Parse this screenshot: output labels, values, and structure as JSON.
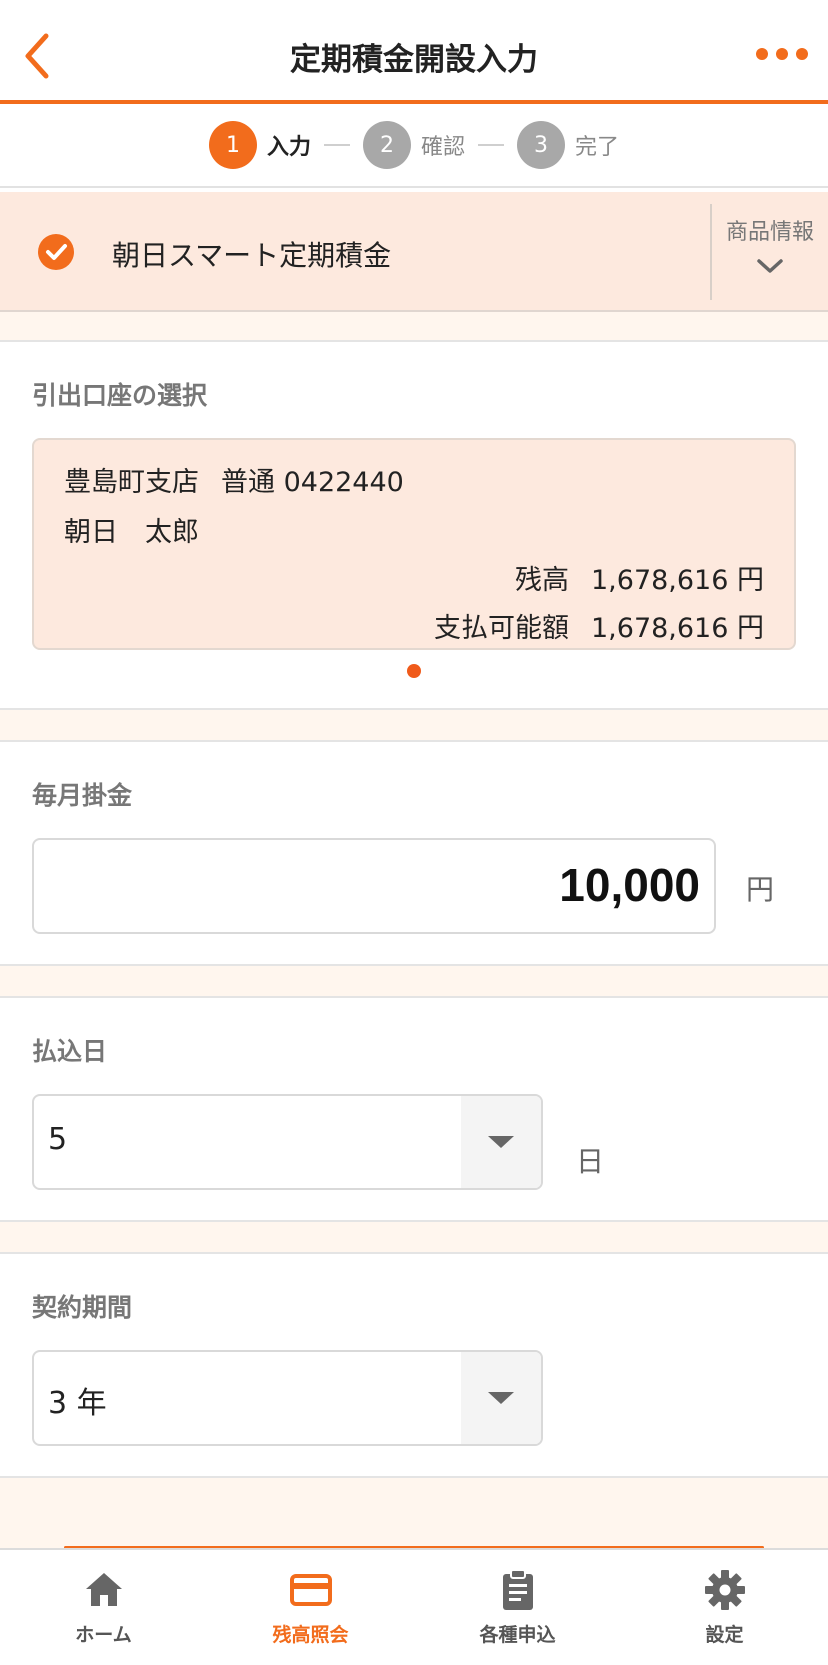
{
  "header": {
    "title": "定期積金開設入力"
  },
  "steps": [
    {
      "num": "1",
      "label": "入力",
      "active": true
    },
    {
      "num": "2",
      "label": "確認",
      "active": false
    },
    {
      "num": "3",
      "label": "完了",
      "active": false
    }
  ],
  "product": {
    "name": "朝日スマート定期積金",
    "info_label": "商品情報"
  },
  "account_section": {
    "title": "引出口座の選択",
    "branch": "豊島町支店",
    "account": "普通 0422440",
    "holder": "朝日　太郎",
    "balance_label": "残高",
    "balance_value": "1,678,616 円",
    "available_label": "支払可能額",
    "available_value": "1,678,616 円"
  },
  "monthly_section": {
    "title": "毎月掛金",
    "value": "10,000",
    "unit": "円"
  },
  "payment_day_section": {
    "title": "払込日",
    "value": "5",
    "unit": "日"
  },
  "term_section": {
    "title": "契約期間",
    "value": "3 年"
  },
  "tabbar": {
    "home": "ホーム",
    "balance": "残高照会",
    "applications": "各種申込",
    "settings": "設定"
  },
  "colors": {
    "accent": "#f26c1c",
    "panel": "#fde9de",
    "band": "#fff6ee"
  }
}
